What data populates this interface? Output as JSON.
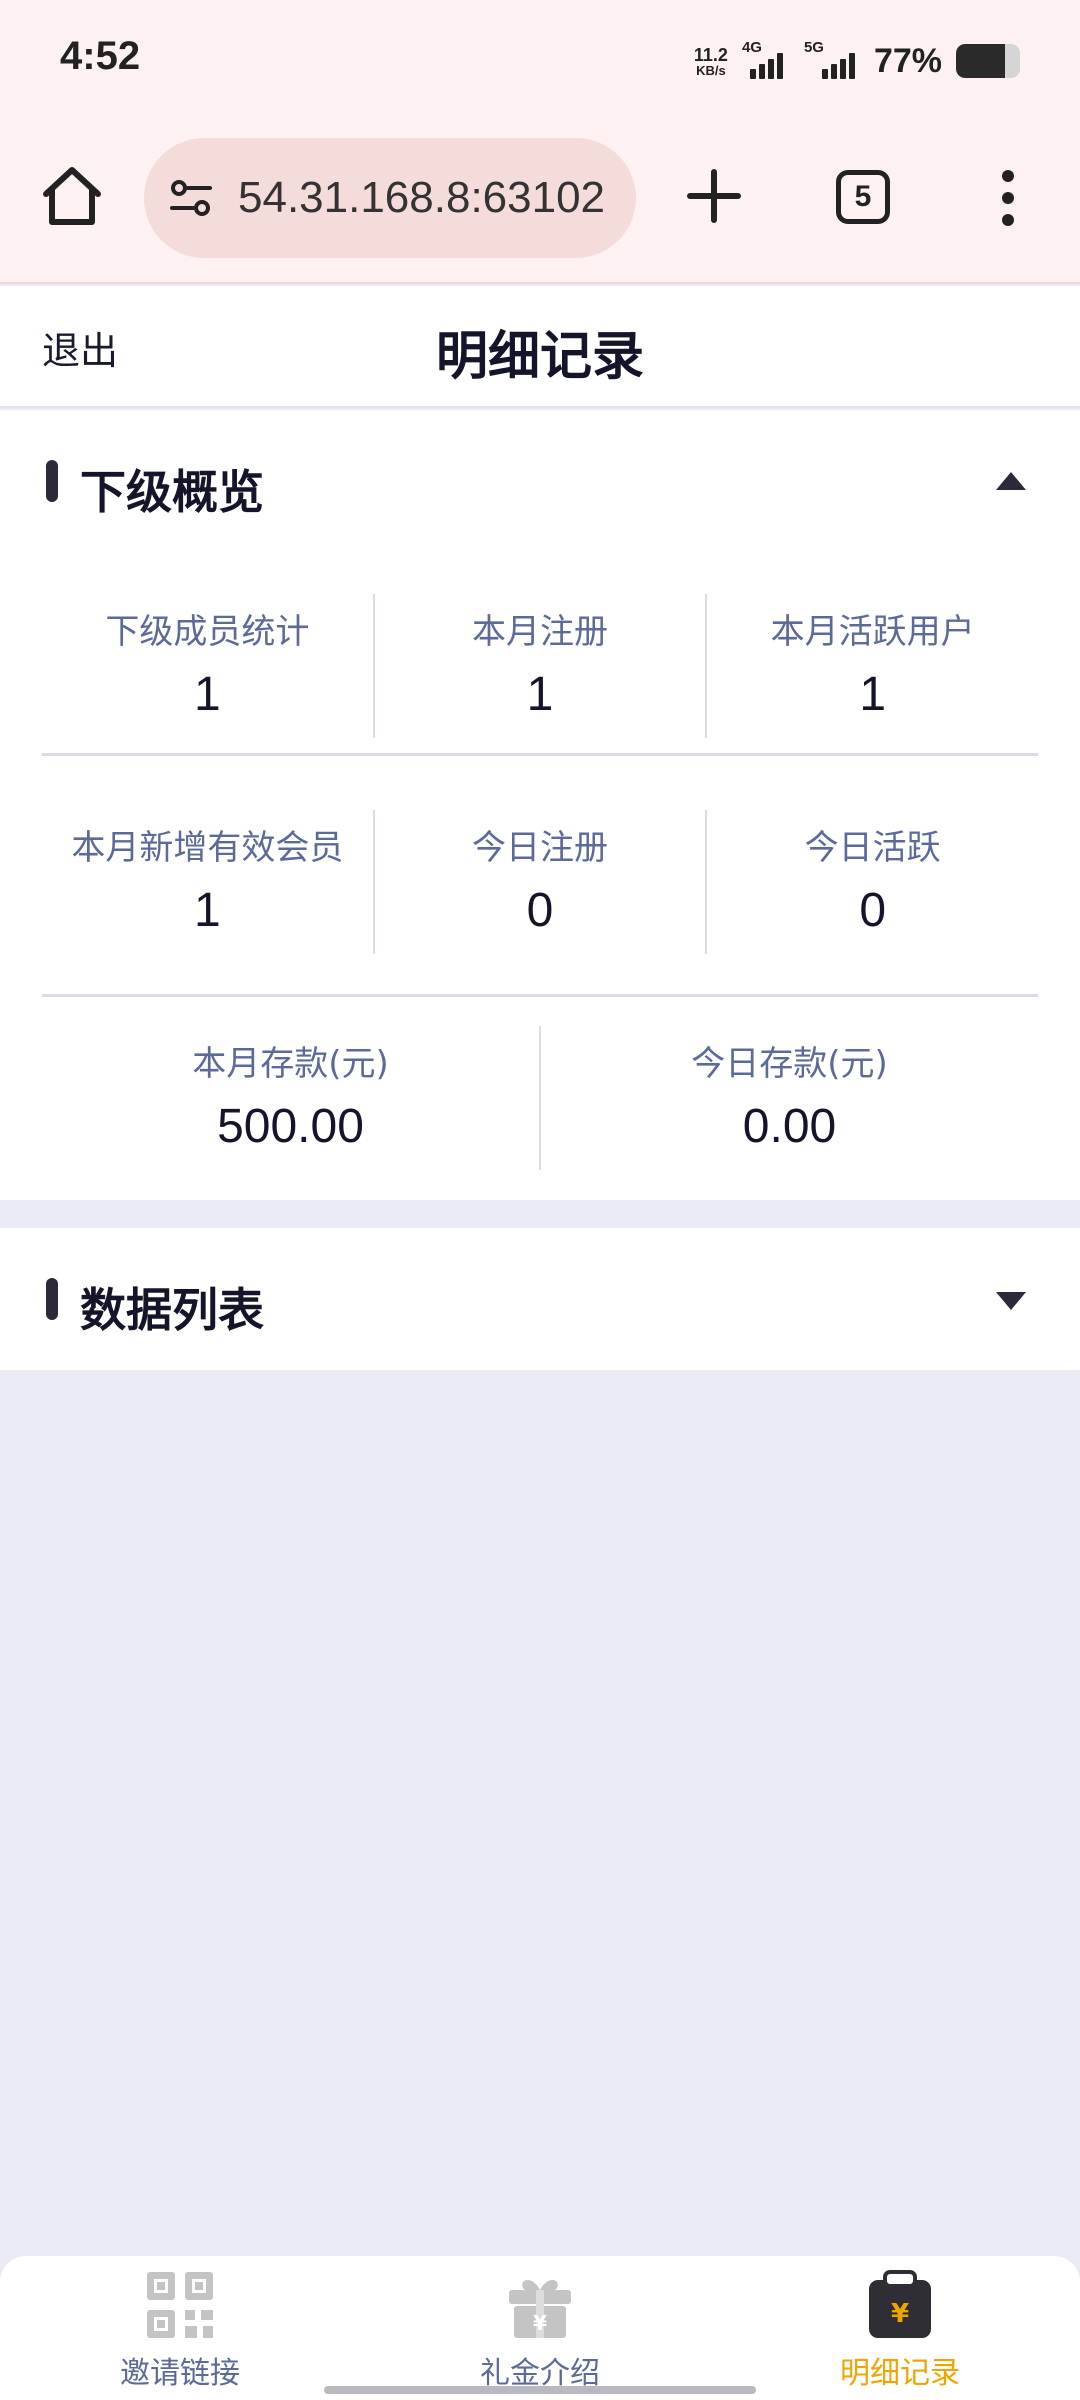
{
  "status_bar": {
    "time": "4:52",
    "net_speed_value": "11.2",
    "net_speed_unit": "KB/s",
    "signal1_label": "4G",
    "signal2_label": "5G",
    "battery_percent": "77%",
    "battery_level": 0.77
  },
  "browser": {
    "url": "54.31.168.8:63102",
    "tab_count": "5",
    "icons": [
      "home-icon",
      "site-settings-icon",
      "plus-icon",
      "menu-icon"
    ]
  },
  "header": {
    "logout_label": "退出",
    "title": "明细记录"
  },
  "overview": {
    "title": "下级概览",
    "stats": [
      {
        "label": "下级成员统计",
        "value": "1"
      },
      {
        "label": "本月注册",
        "value": "1"
      },
      {
        "label": "本月活跃用户",
        "value": "1"
      },
      {
        "label": "本月新增有效会员",
        "value": "1"
      },
      {
        "label": "今日注册",
        "value": "0"
      },
      {
        "label": "今日活跃",
        "value": "0"
      },
      {
        "label": "本月存款(元)",
        "value": "500.00"
      },
      {
        "label": "今日存款(元)",
        "value": "0.00"
      }
    ]
  },
  "data_list": {
    "title": "数据列表"
  },
  "bottom_nav": {
    "items": [
      {
        "label": "邀请链接",
        "icon": "qr-code-icon"
      },
      {
        "label": "礼金介绍",
        "icon": "gift-icon"
      },
      {
        "label": "明细记录",
        "icon": "yuan-record-icon",
        "active": true
      }
    ],
    "active_color": "#f2a400",
    "inactive_color": "#5c6a9a"
  }
}
